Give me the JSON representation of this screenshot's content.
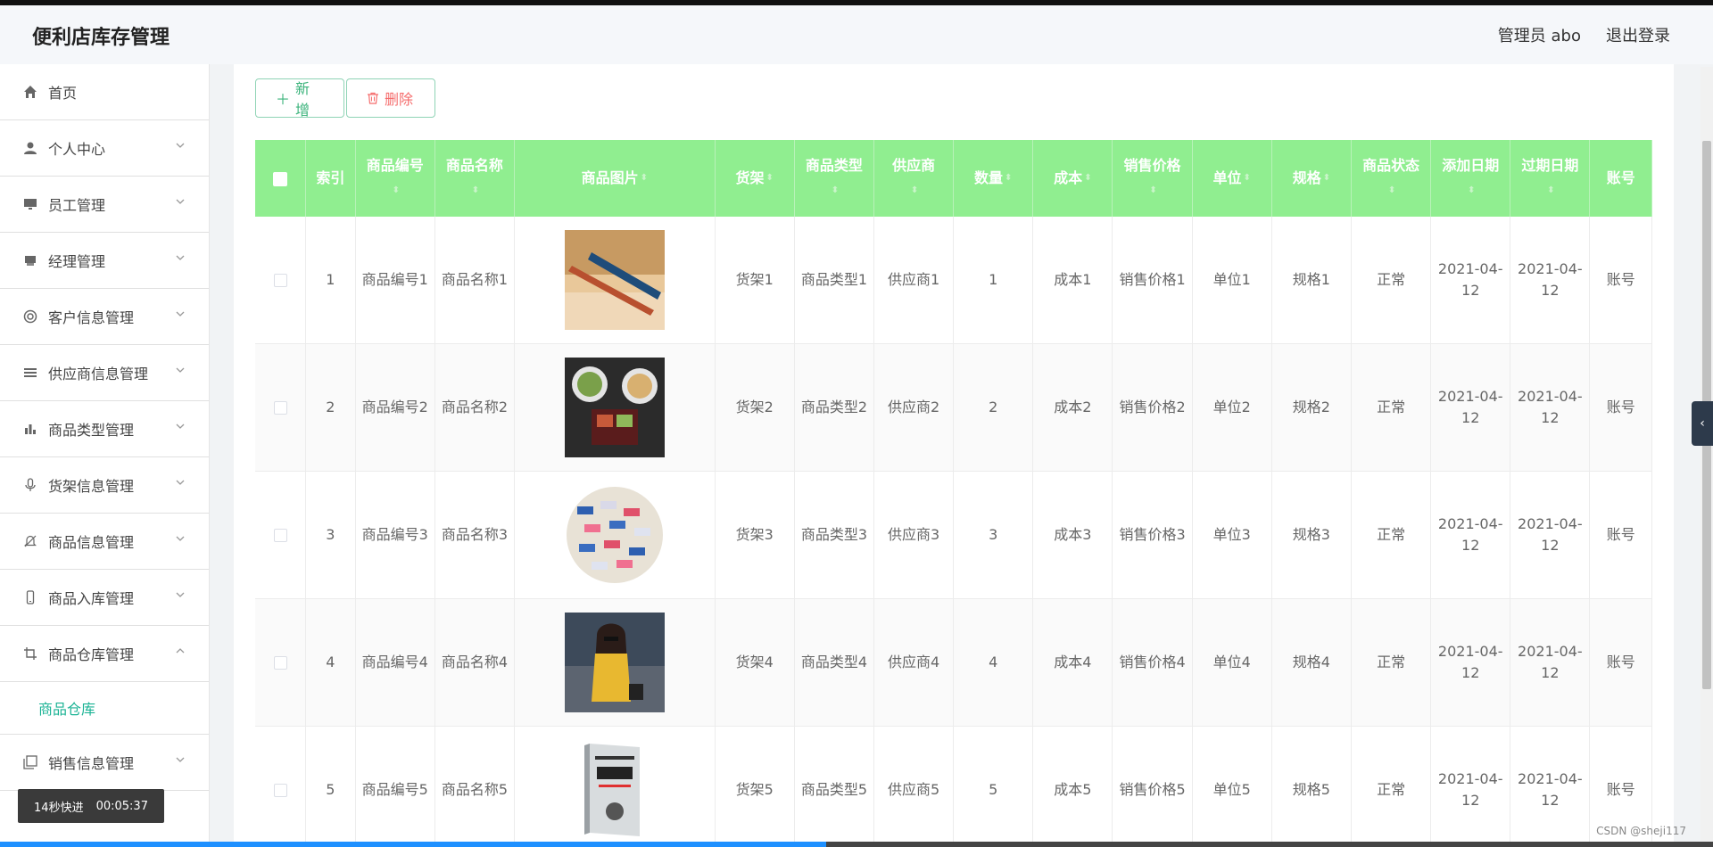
{
  "app": {
    "title": "便利店库存管理",
    "user_label": "管理员 abo",
    "logout_label": "退出登录"
  },
  "sidebar": {
    "items": [
      {
        "label": "首页",
        "icon": "home-icon",
        "has_chevron": false
      },
      {
        "label": "个人中心",
        "icon": "user-icon",
        "has_chevron": true
      },
      {
        "label": "员工管理",
        "icon": "monitor-icon",
        "has_chevron": true
      },
      {
        "label": "经理管理",
        "icon": "printer-icon",
        "has_chevron": true
      },
      {
        "label": "客户信息管理",
        "icon": "lifebuoy-icon",
        "has_chevron": true
      },
      {
        "label": "供应商信息管理",
        "icon": "list-icon",
        "has_chevron": true
      },
      {
        "label": "商品类型管理",
        "icon": "bar-chart-icon",
        "has_chevron": true
      },
      {
        "label": "货架信息管理",
        "icon": "microphone-icon",
        "has_chevron": true
      },
      {
        "label": "商品信息管理",
        "icon": "bell-off-icon",
        "has_chevron": true
      },
      {
        "label": "商品入库管理",
        "icon": "mobile-icon",
        "has_chevron": true
      },
      {
        "label": "商品仓库管理",
        "icon": "crop-icon",
        "has_chevron": true,
        "open": true
      },
      {
        "label": "销售信息管理",
        "icon": "copy-icon",
        "has_chevron": true
      }
    ],
    "submenu_active": "商品仓库"
  },
  "toolbar": {
    "add_label": "新增",
    "delete_label": "删除"
  },
  "table": {
    "headers": [
      "索引",
      "商品编号",
      "商品名称",
      "商品图片",
      "货架",
      "商品类型",
      "供应商",
      "数量",
      "成本",
      "销售价格",
      "单位",
      "规格",
      "商品状态",
      "添加日期",
      "过期日期",
      "账号"
    ],
    "rows": [
      {
        "index": "1",
        "code": "商品编号1",
        "name": "商品名称1",
        "image": "kayak-photo",
        "shelf": "货架1",
        "type": "商品类型1",
        "supplier": "供应商1",
        "qty": "1",
        "cost": "成本1",
        "price": "销售价格1",
        "unit": "单位1",
        "spec": "规格1",
        "status": "正常",
        "added": "2021-04-12",
        "expire": "2021-04-12",
        "account": "账号"
      },
      {
        "index": "2",
        "code": "商品编号2",
        "name": "商品名称2",
        "image": "bento-photo",
        "shelf": "货架2",
        "type": "商品类型2",
        "supplier": "供应商2",
        "qty": "2",
        "cost": "成本2",
        "price": "销售价格2",
        "unit": "单位2",
        "spec": "规格2",
        "status": "正常",
        "added": "2021-04-12",
        "expire": "2021-04-12",
        "account": "账号"
      },
      {
        "index": "3",
        "code": "商品编号3",
        "name": "商品名称3",
        "image": "candy-photo",
        "shelf": "货架3",
        "type": "商品类型3",
        "supplier": "供应商3",
        "qty": "3",
        "cost": "成本3",
        "price": "销售价格3",
        "unit": "单位3",
        "spec": "规格3",
        "status": "正常",
        "added": "2021-04-12",
        "expire": "2021-04-12",
        "account": "账号"
      },
      {
        "index": "4",
        "code": "商品编号4",
        "name": "商品名称4",
        "image": "woman-photo",
        "shelf": "货架4",
        "type": "商品类型4",
        "supplier": "供应商4",
        "qty": "4",
        "cost": "成本4",
        "price": "销售价格4",
        "unit": "单位4",
        "spec": "规格4",
        "status": "正常",
        "added": "2021-04-12",
        "expire": "2021-04-12",
        "account": "账号"
      },
      {
        "index": "5",
        "code": "商品编号5",
        "name": "商品名称5",
        "image": "book-photo",
        "shelf": "货架5",
        "type": "商品类型5",
        "supplier": "供应商5",
        "qty": "5",
        "cost": "成本5",
        "price": "销售价格5",
        "unit": "单位5",
        "spec": "规格5",
        "status": "正常",
        "added": "2021-04-12",
        "expire": "2021-04-12",
        "account": "账号"
      }
    ]
  },
  "video": {
    "speed_label": "14秒快进",
    "time_label": "00:05:37"
  },
  "watermark": "CSDN @sheji117",
  "colors": {
    "header_green": "#90ee90",
    "accent_teal": "#1ab394",
    "delete_red": "#f56c6c"
  }
}
